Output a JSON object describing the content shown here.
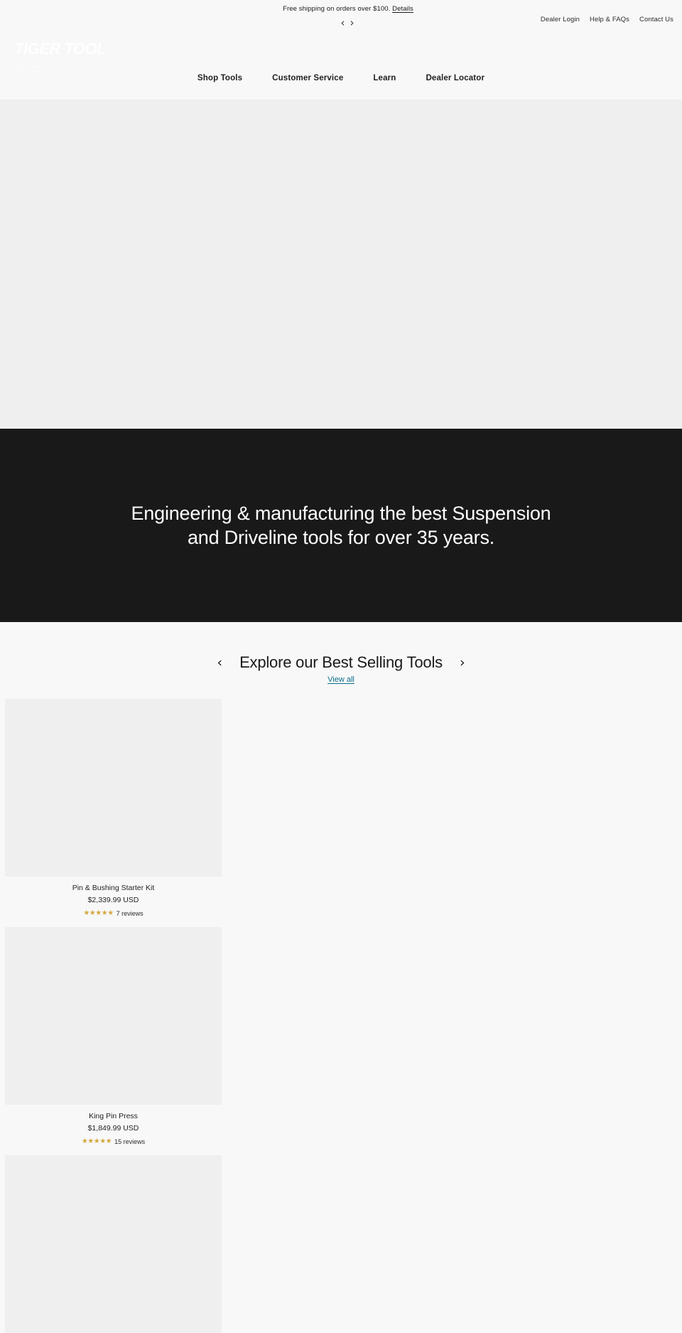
{
  "announcement": {
    "message": "Free shipping on orders over $100.",
    "details_label": "Details",
    "prev_icon": "chevron-left-icon",
    "next_icon": "chevron-right-icon"
  },
  "utility_nav": {
    "items": [
      {
        "label": "Dealer Login"
      },
      {
        "label": "Help & FAQs"
      },
      {
        "label": "Contact Us"
      }
    ]
  },
  "header": {
    "logo_text": "TIGER TOOL",
    "icons": [
      {
        "name": "search-icon"
      },
      {
        "name": "cart-icon"
      }
    ]
  },
  "main_nav": {
    "items": [
      {
        "label": "Shop Tools"
      },
      {
        "label": "Customer Service"
      },
      {
        "label": "Learn"
      },
      {
        "label": "Dealer Locator"
      }
    ]
  },
  "statement": {
    "heading": "Engineering & manufacturing the best Suspension and Driveline tools for over 35 years."
  },
  "bestsellers": {
    "heading": "Explore our Best Selling Tools",
    "view_all_label": "View all",
    "prev_icon": "chevron-left-icon",
    "next_icon": "chevron-right-icon",
    "star_color": "#d3a83f",
    "link_color": "#0b6e8c",
    "products": [
      {
        "title": "Pin & Bushing Starter Kit",
        "price": "$2,339.99 USD",
        "stars": "★★★★★",
        "rating": 5,
        "reviews": "7 reviews"
      },
      {
        "title": "King Pin Press",
        "price": "$1,849.99 USD",
        "stars": "★★★★★",
        "rating": 5,
        "reviews": "15 reviews"
      },
      {
        "title": "",
        "price": "",
        "stars": "",
        "rating": 0,
        "reviews": ""
      }
    ]
  }
}
